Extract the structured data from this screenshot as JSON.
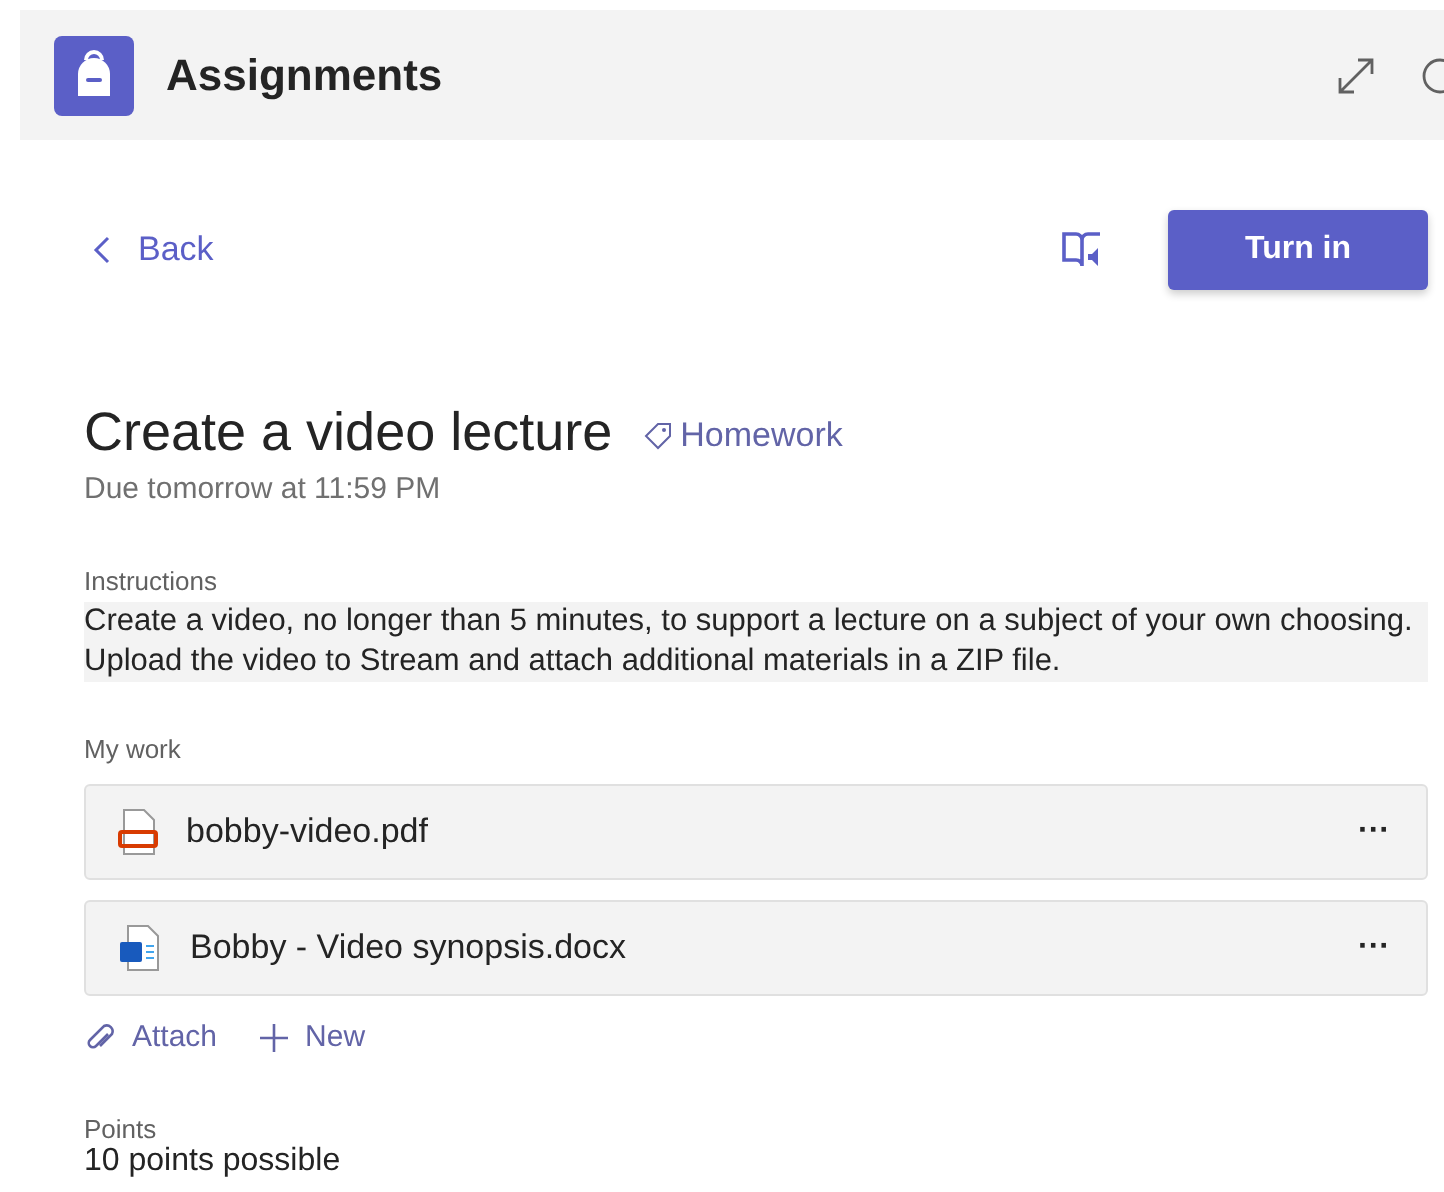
{
  "app_bar": {
    "title": "Assignments"
  },
  "back": {
    "label": "Back"
  },
  "turn_in": {
    "label": "Turn in"
  },
  "assignment": {
    "title": "Create a video lecture",
    "tag": "Homework",
    "due": "Due tomorrow at 11:59 PM"
  },
  "instructions": {
    "label": "Instructions",
    "text": "Create a video, no longer than 5 minutes, to support a lecture on a subject of your own choosing. Upload the video to Stream and attach additional materials in a ZIP file."
  },
  "my_work": {
    "label": "My work",
    "files": [
      {
        "kind": "pdf",
        "name": "bobby-video.pdf",
        "menu": "···"
      },
      {
        "kind": "docx",
        "name": "Bobby - Video synopsis.docx",
        "menu": "···"
      }
    ],
    "actions": [
      {
        "kind": "attach",
        "label": "Attach"
      },
      {
        "kind": "new",
        "label": "New"
      }
    ]
  },
  "points": {
    "label": "Points",
    "value": "10 points possible"
  }
}
